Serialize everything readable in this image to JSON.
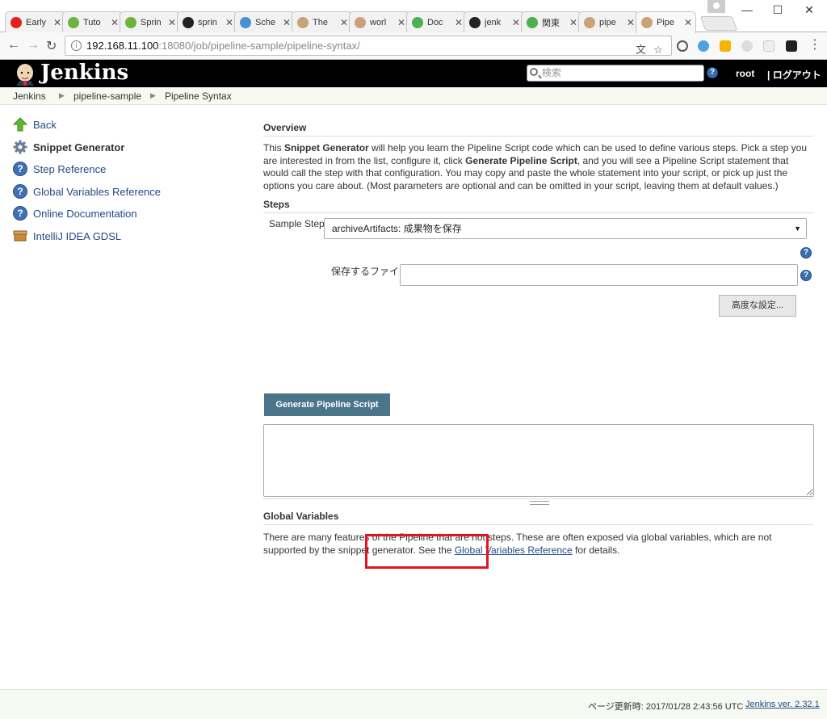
{
  "browser": {
    "tabs": [
      {
        "label": "Early",
        "color": "#e62117"
      },
      {
        "label": "Tuto",
        "color": "#6db33f"
      },
      {
        "label": "Sprin",
        "color": "#6db33f"
      },
      {
        "label": "sprin",
        "color": "#222222"
      },
      {
        "label": "Sche",
        "color": "#4a90d9"
      },
      {
        "label": "The",
        "color": "#c9a27a"
      },
      {
        "label": "worl",
        "color": "#c9a27a"
      },
      {
        "label": "Doc",
        "color": "#4caf50"
      },
      {
        "label": "jenk",
        "color": "#222222"
      },
      {
        "label": "関東",
        "color": "#4caf50"
      },
      {
        "label": "pipe",
        "color": "#c9a27a"
      },
      {
        "label": "Pipe",
        "color": "#c9a27a",
        "active": true
      }
    ],
    "url_host": "192.168.11.100",
    "url_rest": ":18080/job/pipeline-sample/pipeline-syntax/"
  },
  "header": {
    "title": "Jenkins",
    "search_placeholder": "検索",
    "user": "root",
    "logout": "| ログアウト"
  },
  "breadcrumb": [
    "Jenkins",
    "pipeline-sample",
    "Pipeline Syntax"
  ],
  "sidebar": {
    "items": [
      {
        "label": "Back",
        "icon": "up-arrow-icon"
      },
      {
        "label": "Snippet Generator",
        "icon": "gear-icon"
      },
      {
        "label": "Step Reference",
        "icon": "help-icon"
      },
      {
        "label": "Global Variables Reference",
        "icon": "help-icon"
      },
      {
        "label": "Online Documentation",
        "icon": "help-icon"
      },
      {
        "label": "IntelliJ IDEA GDSL",
        "icon": "package-icon"
      }
    ]
  },
  "overview": {
    "heading": "Overview",
    "p1": "This ",
    "b1": "Snippet Generator",
    "p2": " will help you learn the Pipeline Script code which can be used to define various steps. Pick a step you are interested in from the list, configure it, click ",
    "b2": "Generate Pipeline Script",
    "p3": ", and you will see a Pipeline Script statement that would call the step with that configuration. You may copy and paste the whole statement into your script, or pick up just the options you care about. (Most parameters are optional and can be omitted in your script, leaving them at default values.)"
  },
  "steps": {
    "heading": "Steps",
    "sample_label": "Sample Step",
    "selected": "archiveArtifacts: 成果物を保存",
    "file_label": "保存するファイル",
    "file_value": "",
    "advanced_button": "高度な設定...",
    "generate_button": "Generate Pipeline Script",
    "output": ""
  },
  "globals": {
    "heading": "Global Variables",
    "p1": "There are many features of the Pipeline that are not steps. These are often exposed via global variables, which are not supported by the snippet generator. See the ",
    "link": "Global Variables Reference",
    "p2": " for details."
  },
  "footer": {
    "updated": "ページ更新時: 2017/01/28 2:43:56 UTC",
    "version": "Jenkins ver. 2.32.1"
  },
  "colors": {
    "highlight": "#e1171f",
    "link": "#204a87",
    "generate_button": "#4b758b"
  }
}
